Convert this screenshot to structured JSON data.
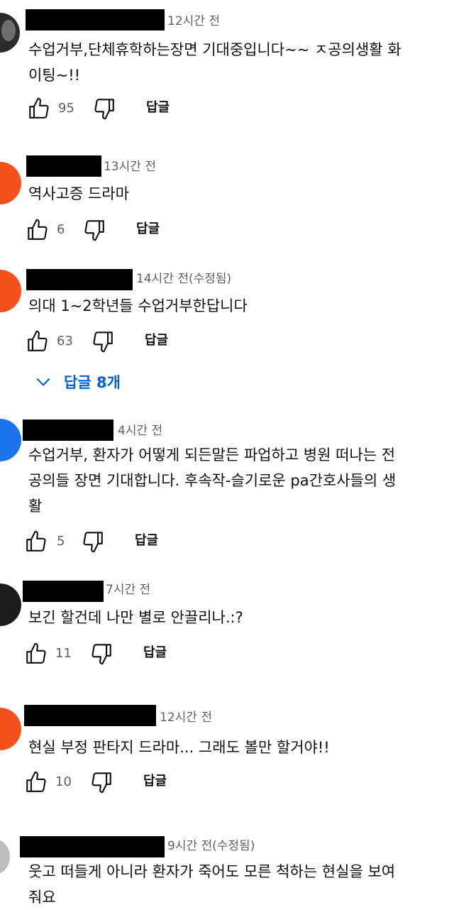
{
  "colors": {
    "avatar_gray": "#2b2b2b",
    "avatar_orange": "#f4511e",
    "avatar_blue": "#1a73e8",
    "link_blue": "#065fd4",
    "meta_gray": "#606060"
  },
  "comments": [
    {
      "time": "12시간 전",
      "text": "수업거부,단체휴학하는장면 기대중입니다~~ ㅈ공의생활 화\n이팅~!!",
      "likes": "95",
      "reply": "답글",
      "avatar": "avatar_gray"
    },
    {
      "time": "13시간 전",
      "text": "역사고증 드라마",
      "likes": "6",
      "reply": "답글",
      "avatar": "avatar_orange"
    },
    {
      "time": "14시간 전(수정됨)",
      "text": "의대 1~2학년들 수업거부한답니다",
      "likes": "63",
      "reply": "답글",
      "avatar": "avatar_orange"
    },
    {
      "time": "4시간 전",
      "text": "수업거부, 환자가 어떻게 되든말든 파업하고 병원 떠나는 전\n공의들 장면 기대합니다. 후속작-슬기로운 pa간호사들의 생\n활",
      "likes": "5",
      "reply": "답글",
      "avatar": "avatar_blue"
    },
    {
      "time": "7시간 전",
      "text": "보긴 할건데 나만 별로 안끌리나.:?",
      "likes": "11",
      "reply": "답글",
      "avatar": "avatar_gray"
    },
    {
      "time": "12시간 전",
      "text": "현실 부정 판타지 드라마... 그래도 볼만 할거야!!",
      "likes": "10",
      "reply": "답글",
      "avatar": "avatar_orange"
    },
    {
      "time": "9시간 전(수정됨)",
      "text": "웃고 떠들게 아니라 환자가 죽어도 모른 척하는 현실을 보여\n줘요",
      "likes": "",
      "reply": "",
      "avatar": "avatar_gray"
    }
  ],
  "replies_toggle": {
    "label": "답글 8개",
    "icon": "chevron-down-icon"
  }
}
